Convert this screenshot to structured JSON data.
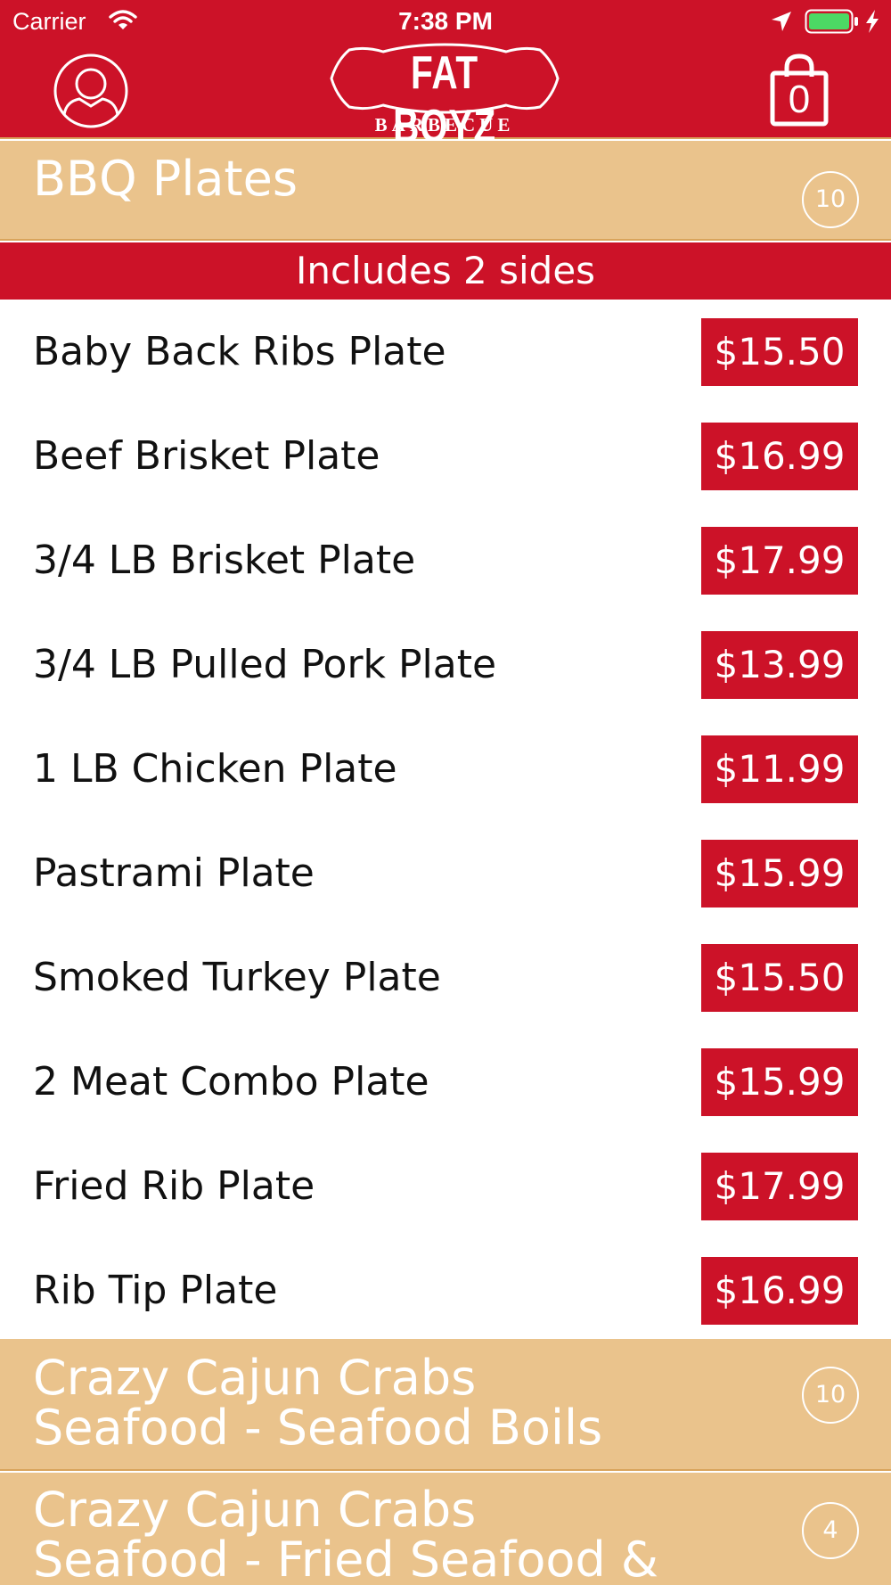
{
  "status_bar": {
    "carrier": "Carrier",
    "time": "7:38 PM"
  },
  "header": {
    "logo_main": "FAT BOYZ",
    "logo_sub": "BARBECUE",
    "cart_count": "0"
  },
  "menu": {
    "category_1": {
      "title": "BBQ Plates",
      "count": "10"
    },
    "subheader": "Includes 2 sides",
    "items": [
      {
        "name": "Baby Back Ribs Plate",
        "price": "$15.50"
      },
      {
        "name": "Beef Brisket Plate",
        "price": "$16.99"
      },
      {
        "name": "3/4 LB Brisket Plate",
        "price": "$17.99"
      },
      {
        "name": "3/4 LB Pulled Pork Plate",
        "price": "$13.99"
      },
      {
        "name": "1 LB Chicken Plate",
        "price": "$11.99"
      },
      {
        "name": "Pastrami Plate",
        "price": "$15.99"
      },
      {
        "name": "Smoked Turkey Plate",
        "price": "$15.50"
      },
      {
        "name": "2 Meat Combo Plate",
        "price": "$15.99"
      },
      {
        "name": "Fried Rib Plate",
        "price": "$17.99"
      },
      {
        "name": "Rib Tip Plate",
        "price": "$16.99"
      }
    ],
    "category_2": {
      "title_line1": "Crazy Cajun Crabs",
      "title_line2": "Seafood - Seafood Boils",
      "count": "10"
    },
    "category_3": {
      "title_line1": "Crazy Cajun Crabs",
      "title_line2": "Seafood - Fried Seafood &",
      "count": "4"
    }
  },
  "colors": {
    "brand_red": "#cc1228",
    "category_tan": "#eac38c",
    "battery_green": "#4cd964"
  },
  "icons": [
    "wifi-icon",
    "location-arrow-icon",
    "battery-icon",
    "charging-bolt-icon",
    "profile-icon",
    "shopping-bag-icon"
  ]
}
